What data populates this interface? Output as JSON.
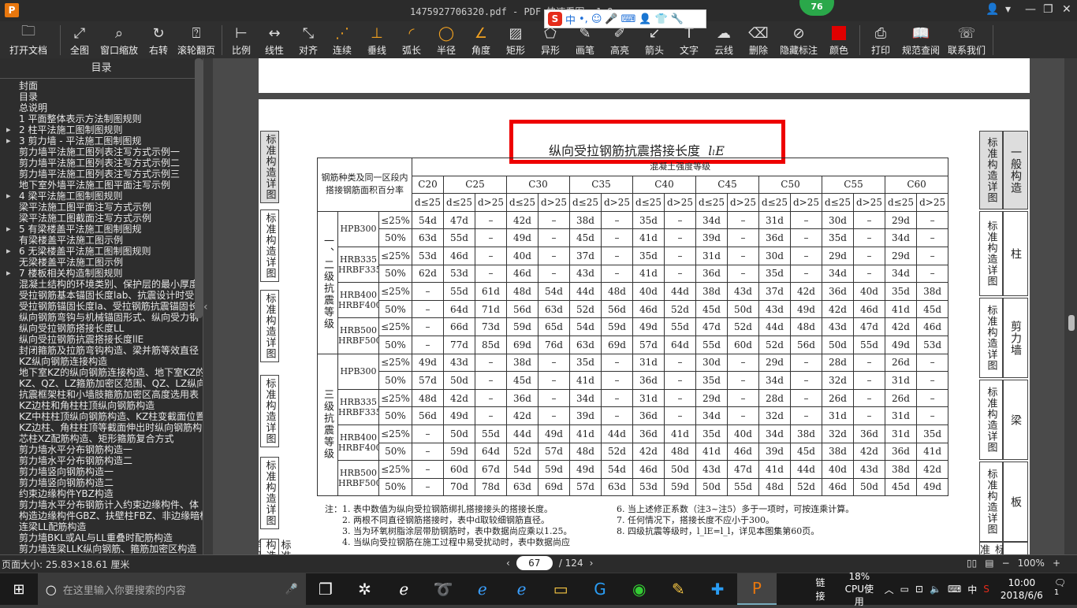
{
  "window": {
    "title": "1475927706320.pdf - PDF 快速看图 v1.9",
    "badge": "76",
    "app_logo": "P"
  },
  "ime": {
    "logo": "S",
    "lang": "中",
    "punct": "•,",
    "icons": [
      "smile-icon",
      "mic-icon",
      "keyboard-icon",
      "user-icon",
      "shirt-icon",
      "wrench-icon"
    ]
  },
  "toolbar": {
    "buttons": [
      {
        "label": "打开文档",
        "icon": "folder-icon"
      },
      {
        "label": "全图",
        "icon": "expand-icon"
      },
      {
        "label": "窗口缩放",
        "icon": "magnifier-icon"
      },
      {
        "label": "右转",
        "icon": "rotate-right-icon"
      },
      {
        "label": "滚轮翻页",
        "icon": "mouse-icon"
      },
      {
        "label": "比例",
        "icon": "scale-icon"
      },
      {
        "label": "线性",
        "icon": "linear-dimension-icon"
      },
      {
        "label": "对齐",
        "icon": "aligned-dimension-icon"
      },
      {
        "label": "连续",
        "icon": "continuous-dimension-icon"
      },
      {
        "label": "垂线",
        "icon": "perpendicular-icon"
      },
      {
        "label": "弧长",
        "icon": "arc-length-icon"
      },
      {
        "label": "半径",
        "icon": "radius-icon"
      },
      {
        "label": "角度",
        "icon": "angle-icon"
      },
      {
        "label": "矩形",
        "icon": "rectangle-area-icon"
      },
      {
        "label": "异形",
        "icon": "polygon-area-icon"
      },
      {
        "label": "画笔",
        "icon": "pen-icon"
      },
      {
        "label": "高亮",
        "icon": "highlighter-icon"
      },
      {
        "label": "箭头",
        "icon": "arrow-icon"
      },
      {
        "label": "文字",
        "icon": "text-icon"
      },
      {
        "label": "云线",
        "icon": "cloud-line-icon"
      },
      {
        "label": "删除",
        "icon": "eraser-icon"
      },
      {
        "label": "隐藏标注",
        "icon": "hide-eye-icon"
      },
      {
        "label": "颜色",
        "icon": "color-swatch-icon",
        "color": "#e00000"
      },
      {
        "label": "打印",
        "icon": "printer-icon"
      },
      {
        "label": "规范查阅",
        "icon": "book-icon"
      },
      {
        "label": "联系我们",
        "icon": "support-icon"
      }
    ]
  },
  "sidebar": {
    "header": "目录",
    "items": [
      {
        "t": "封面",
        "ex": false
      },
      {
        "t": "目录",
        "ex": false
      },
      {
        "t": "总说明",
        "ex": false
      },
      {
        "t": "1 平面整体表示方法制图规则",
        "ex": false
      },
      {
        "t": "2 柱平法施工图制图规则",
        "ex": true
      },
      {
        "t": "3 剪力墙 - 平法施工图制图规",
        "ex": true
      },
      {
        "t": "剪力墙平法施工图列表注写方式示例一",
        "ex": false
      },
      {
        "t": "剪力墙平法施工图列表注写方式示例二",
        "ex": false
      },
      {
        "t": "剪力墙平法施工图列表注写方式示例三",
        "ex": false
      },
      {
        "t": "地下室外墙平法施工图平面注写示例",
        "ex": false
      },
      {
        "t": "4 梁平法施工图制图规则",
        "ex": true
      },
      {
        "t": "梁平法施工图平面注写方式示例",
        "ex": false
      },
      {
        "t": "梁平法施工图截面注写方式示例",
        "ex": false
      },
      {
        "t": "5 有梁楼盖平法施工图制图规",
        "ex": true
      },
      {
        "t": "有梁楼盖平法施工图示例",
        "ex": false
      },
      {
        "t": "6 无梁楼盖平法施工图制图规则",
        "ex": true
      },
      {
        "t": "无梁楼盖平法施工图示例",
        "ex": false
      },
      {
        "t": "7 楼板相关构造制图规则",
        "ex": true
      },
      {
        "t": "混凝土结构的环境类别、保护层的最小厚度",
        "ex": false
      },
      {
        "t": "受拉钢筋基本锚固长度lab、抗震设计时受",
        "ex": false
      },
      {
        "t": "受拉钢筋锚固长度la、受拉钢筋抗震锚固长",
        "ex": false
      },
      {
        "t": "纵向钢筋弯钩与机械锚固形式、纵向受力钢",
        "ex": false
      },
      {
        "t": "纵向受拉钢筋搭接长度LL",
        "ex": false
      },
      {
        "t": "纵向受拉钢筋抗震搭接长度llE",
        "ex": false
      },
      {
        "t": "封闭箍筋及拉筋弯钩构造、梁并筋等效直径",
        "ex": false
      },
      {
        "t": "KZ纵向钢筋连接构造",
        "ex": false
      },
      {
        "t": "地下室KZ的纵向钢筋连接构造、地下室KZ的",
        "ex": false
      },
      {
        "t": "KZ、QZ、LZ箍筋加密区范围、QZ、LZ纵向钢",
        "ex": false
      },
      {
        "t": "抗震框架柱和小墙肢箍筋加密区高度选用表",
        "ex": false
      },
      {
        "t": "KZ边柱和角柱柱顶纵向钢筋构造",
        "ex": false
      },
      {
        "t": "KZ中柱柱顶纵向钢筋构造、KZ柱变截面位置",
        "ex": false
      },
      {
        "t": "KZ边柱、角柱柱顶等截面伸出时纵向钢筋构",
        "ex": false
      },
      {
        "t": "芯柱XZ配筋构造、矩形箍筋复合方式",
        "ex": false
      },
      {
        "t": "剪力墙水平分布钢筋构造一",
        "ex": false
      },
      {
        "t": "剪力墙水平分布钢筋构造二",
        "ex": false
      },
      {
        "t": "剪力墙竖向钢筋构造一",
        "ex": false
      },
      {
        "t": "剪力墙竖向钢筋构造二",
        "ex": false
      },
      {
        "t": "约束边缘构件YBZ构造",
        "ex": false
      },
      {
        "t": "剪力墙水平分布钢筋计入约束边缘构件、体",
        "ex": false
      },
      {
        "t": "构造边缘构件GBZ、扶壁柱FBZ、非边缘暗柱",
        "ex": false
      },
      {
        "t": "连梁LL配筋构造",
        "ex": false
      },
      {
        "t": "剪力墙BKL或AL与LL重叠时配筋构造",
        "ex": false
      },
      {
        "t": "剪力墙连梁LLK纵向钢筋、箍筋加密区构造",
        "ex": false
      }
    ]
  },
  "page": {
    "title": "纵向受拉钢筋抗震搭接长度",
    "title_symbol": "lₗE",
    "left_labels": [
      "标准构造详图",
      "标准构造详图",
      "标准构造详图",
      "标准构造详图",
      "标准构造详图",
      "标准构造详图"
    ],
    "right_tabs": [
      {
        "a": "标准构造详图",
        "b": "一般构造"
      },
      {
        "a": "标准构造详图",
        "b": "柱"
      },
      {
        "a": "标准构造详图",
        "b": "剪力墙"
      },
      {
        "a": "标准构造详图",
        "b": "梁"
      },
      {
        "a": "标准构造详图",
        "b": "板"
      },
      {
        "a": "标准",
        "b": ""
      }
    ],
    "table": {
      "header_left": "钢筋种类及同一区段内搭接钢筋面积百分率",
      "header_span": "混凝土强度等级",
      "grades": [
        "C20",
        "C25",
        "C30",
        "C35",
        "C40",
        "C45",
        "C50",
        "C55",
        "C60"
      ],
      "sub": [
        "d≤25",
        "d>25"
      ],
      "groups": [
        {
          "name": "一、二级抗震等级",
          "rows": [
            {
              "cat": "HPB300",
              "pct": "≤25%",
              "v": [
                "54d",
                "47d",
                "–",
                "42d",
                "–",
                "38d",
                "–",
                "35d",
                "–",
                "34d",
                "–",
                "31d",
                "–",
                "30d",
                "–",
                "29d",
                "–"
              ]
            },
            {
              "cat": "",
              "pct": "50%",
              "v": [
                "63d",
                "55d",
                "–",
                "49d",
                "–",
                "45d",
                "–",
                "41d",
                "–",
                "39d",
                "–",
                "36d",
                "–",
                "35d",
                "–",
                "34d",
                "–"
              ]
            },
            {
              "cat": "HRB335 HRBF335",
              "pct": "≤25%",
              "v": [
                "53d",
                "46d",
                "–",
                "40d",
                "–",
                "37d",
                "–",
                "35d",
                "–",
                "31d",
                "–",
                "30d",
                "–",
                "29d",
                "–",
                "29d",
                "–"
              ]
            },
            {
              "cat": "",
              "pct": "50%",
              "v": [
                "62d",
                "53d",
                "–",
                "46d",
                "–",
                "43d",
                "–",
                "41d",
                "–",
                "36d",
                "–",
                "35d",
                "–",
                "34d",
                "–",
                "34d",
                "–"
              ]
            },
            {
              "cat": "HRB400 HRBF400",
              "pct": "≤25%",
              "v": [
                "–",
                "55d",
                "61d",
                "48d",
                "54d",
                "44d",
                "48d",
                "40d",
                "44d",
                "38d",
                "43d",
                "37d",
                "42d",
                "36d",
                "40d",
                "35d",
                "38d"
              ]
            },
            {
              "cat": "",
              "pct": "50%",
              "v": [
                "–",
                "64d",
                "71d",
                "56d",
                "63d",
                "52d",
                "56d",
                "46d",
                "52d",
                "45d",
                "50d",
                "43d",
                "49d",
                "42d",
                "46d",
                "41d",
                "45d"
              ]
            },
            {
              "cat": "HRB500 HRBF500",
              "pct": "≤25%",
              "v": [
                "–",
                "66d",
                "73d",
                "59d",
                "65d",
                "54d",
                "59d",
                "49d",
                "55d",
                "47d",
                "52d",
                "44d",
                "48d",
                "43d",
                "47d",
                "42d",
                "46d"
              ]
            },
            {
              "cat": "",
              "pct": "50%",
              "v": [
                "–",
                "77d",
                "85d",
                "69d",
                "76d",
                "63d",
                "69d",
                "57d",
                "64d",
                "55d",
                "60d",
                "52d",
                "56d",
                "50d",
                "55d",
                "49d",
                "53d"
              ]
            }
          ]
        },
        {
          "name": "三级抗震等级",
          "rows": [
            {
              "cat": "HPB300",
              "pct": "≤25%",
              "v": [
                "49d",
                "43d",
                "–",
                "38d",
                "–",
                "35d",
                "–",
                "31d",
                "–",
                "30d",
                "–",
                "29d",
                "–",
                "28d",
                "–",
                "26d",
                "–"
              ]
            },
            {
              "cat": "",
              "pct": "50%",
              "v": [
                "57d",
                "50d",
                "–",
                "45d",
                "–",
                "41d",
                "–",
                "36d",
                "–",
                "35d",
                "–",
                "34d",
                "–",
                "32d",
                "–",
                "31d",
                "–"
              ]
            },
            {
              "cat": "HRB335 HRBF335",
              "pct": "≤25%",
              "v": [
                "48d",
                "42d",
                "–",
                "36d",
                "–",
                "34d",
                "–",
                "31d",
                "–",
                "29d",
                "–",
                "28d",
                "–",
                "26d",
                "–",
                "26d",
                "–"
              ]
            },
            {
              "cat": "",
              "pct": "50%",
              "v": [
                "56d",
                "49d",
                "–",
                "42d",
                "–",
                "39d",
                "–",
                "36d",
                "–",
                "34d",
                "–",
                "32d",
                "–",
                "31d",
                "–",
                "31d",
                "–"
              ]
            },
            {
              "cat": "HRB400 HRBF400",
              "pct": "≤25%",
              "v": [
                "–",
                "50d",
                "55d",
                "44d",
                "49d",
                "41d",
                "44d",
                "36d",
                "41d",
                "35d",
                "40d",
                "34d",
                "38d",
                "32d",
                "36d",
                "31d",
                "35d"
              ]
            },
            {
              "cat": "",
              "pct": "50%",
              "v": [
                "–",
                "59d",
                "64d",
                "52d",
                "57d",
                "48d",
                "52d",
                "42d",
                "48d",
                "41d",
                "46d",
                "39d",
                "45d",
                "38d",
                "42d",
                "36d",
                "41d"
              ]
            },
            {
              "cat": "HRB500 HRBF500",
              "pct": "≤25%",
              "v": [
                "–",
                "60d",
                "67d",
                "54d",
                "59d",
                "49d",
                "54d",
                "46d",
                "50d",
                "43d",
                "47d",
                "41d",
                "44d",
                "40d",
                "43d",
                "38d",
                "42d"
              ]
            },
            {
              "cat": "",
              "pct": "50%",
              "v": [
                "–",
                "70d",
                "78d",
                "63d",
                "69d",
                "57d",
                "63d",
                "53d",
                "59d",
                "50d",
                "55d",
                "48d",
                "52d",
                "46d",
                "50d",
                "45d",
                "49d"
              ]
            }
          ]
        }
      ]
    },
    "notes_left": [
      "注：1. 表中数值为纵向受拉钢筋绑扎搭接接头的搭接长度。",
      "　　2. 两根不同直径钢筋搭接时，表中d取较细钢筋直径。",
      "　　3. 当为环氧树脂涂层带肋钢筋时，表中数据尚应乘以1.25。",
      "　　4. 当纵向受拉钢筋在施工过程中易受扰动时，表中数据尚应"
    ],
    "notes_right": [
      "6. 当上述修正系数（注3~注5）多于一项时，可按连乘计算。",
      "7. 任何情况下，搭接长度不应小于300。",
      "8. 四级抗震等级时，l_lE=l_l，详见本图集第60页。"
    ]
  },
  "status": {
    "page_size": "页面大小: 25.83×18.61 厘米",
    "current_page": "67",
    "total_pages": "/ 124",
    "zoom": "100%"
  },
  "taskbar": {
    "search_placeholder": "在这里输入你要搜索的内容",
    "link_label": "链接",
    "cpu_pct": "18%",
    "cpu_label": "CPU使用",
    "ime": "中",
    "time": "10:00",
    "date": "2018/6/6",
    "notif": "1"
  }
}
